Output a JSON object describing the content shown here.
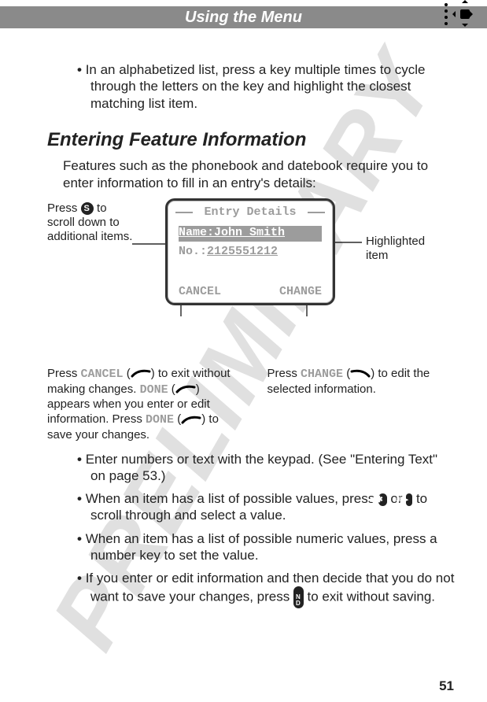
{
  "watermark": "PRELIMINARY",
  "header": {
    "title": "Using the Menu"
  },
  "page_number": "51",
  "intro_bullet": "In an alphabetized list, press a key multiple times to cycle through the letters on the key and highlight the closest matching list item.",
  "section_heading": "Entering Feature Information",
  "section_intro": "Features such as the phonebook and datebook require you to enter information to fill in an entry's details:",
  "screen": {
    "title": "Entry Details",
    "name_label": "Name:",
    "name_value": "John Smith",
    "no_label": "No.:",
    "no_value": "2125551212",
    "left_softkey": "CANCEL",
    "right_softkey": "CHANGE"
  },
  "annotations": {
    "left_top_a": "Press ",
    "left_top_b": " to scroll down to additional items.",
    "right": "Highlighted item",
    "bottom_left": {
      "l1_a": "Press ",
      "l1_b": "CANCEL",
      "l1_c": " (",
      "l1_d": ") to exit without making changes.",
      "l2_a": "DONE",
      "l2_b": " (",
      "l2_c": ") appears when you enter or edit information. Press ",
      "l3_a": "DONE",
      "l3_b": " (",
      "l3_c": ") to save your changes."
    },
    "bottom_right": {
      "l1_a": "Press ",
      "l1_b": "CHANGE",
      "l1_c": " (",
      "l1_d": ") to edit the selected information."
    }
  },
  "bullets": {
    "b2": "Enter numbers or text with the keypad. (See \"Entering Text\" on page 53.)",
    "b3_a": "When an item has a list of possible values, press ",
    "b3_b": " or ",
    "b3_c": " to scroll through and select a value.",
    "b4": "When an item has a list of possible numeric values, press a number key to set the value.",
    "b5_a": "If you enter or edit information and then decide that you do not want to save your changes, press ",
    "b5_b": " to exit without saving."
  }
}
